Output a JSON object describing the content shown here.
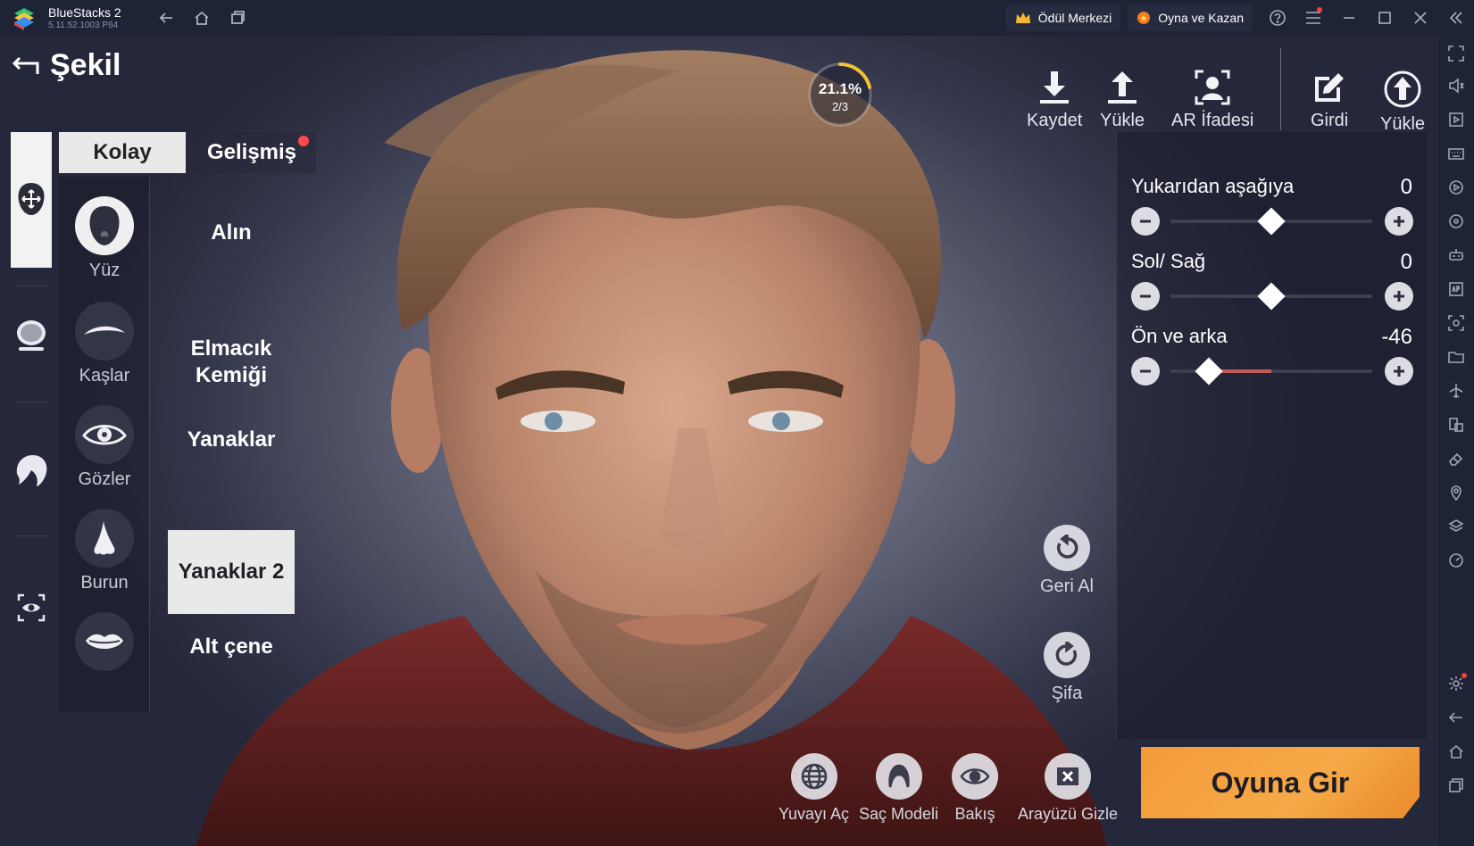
{
  "window": {
    "app_name": "BlueStacks 2",
    "version": "5.11.52.1003  P64",
    "reward_center": "Ödül Merkezi",
    "play_and_win": "Oyna ve Kazan"
  },
  "header": {
    "title": "Şekil"
  },
  "mode_tabs": {
    "easy": "Kolay",
    "advanced": "Gelişmiş"
  },
  "categories": [
    {
      "label": "Yüz",
      "icon": "face-icon",
      "active": true
    },
    {
      "label": "Kaşlar",
      "icon": "eyebrow-icon",
      "active": false
    },
    {
      "label": "Gözler",
      "icon": "eye-icon",
      "active": false
    },
    {
      "label": "Burun",
      "icon": "nose-icon",
      "active": false
    },
    {
      "label": "",
      "icon": "lips-icon",
      "active": false
    }
  ],
  "sub_parts": [
    {
      "label": "Alın"
    },
    {
      "label": "Elmacık\nKemiği"
    },
    {
      "label": "Yanaklar"
    },
    {
      "label": "Yanaklar 2",
      "active": true
    },
    {
      "label": "Alt çene"
    }
  ],
  "progress": {
    "percent_text": "21.1%",
    "step_text": "2/3",
    "percent": 21.1
  },
  "toolbar": {
    "save": "Kaydet",
    "load": "Yükle",
    "ar": "AR İfadesi",
    "entry": "Girdi",
    "upload": "Yükle"
  },
  "sliders": [
    {
      "label": "Yukarıdan aşağıya",
      "value": "0",
      "fraction": 0.5
    },
    {
      "label": "Sol/ Sağ",
      "value": "0",
      "fraction": 0.5
    },
    {
      "label": "Ön ve arka",
      "value": "-46",
      "fraction": 0.19
    }
  ],
  "side_actions": {
    "undo": "Geri Al",
    "redo": "Şifa"
  },
  "bottom_actions": {
    "globe": "Yuvayı Aç",
    "hair": "Saç Modeli",
    "view": "Bakış",
    "hide_ui": "Arayüzü Gizle"
  },
  "enter_game": "Oyuna Gir",
  "colors": {
    "accent_orange": "#f49a3a",
    "slider_fill": "#c55a5a",
    "titlebar": "#1f2336"
  }
}
